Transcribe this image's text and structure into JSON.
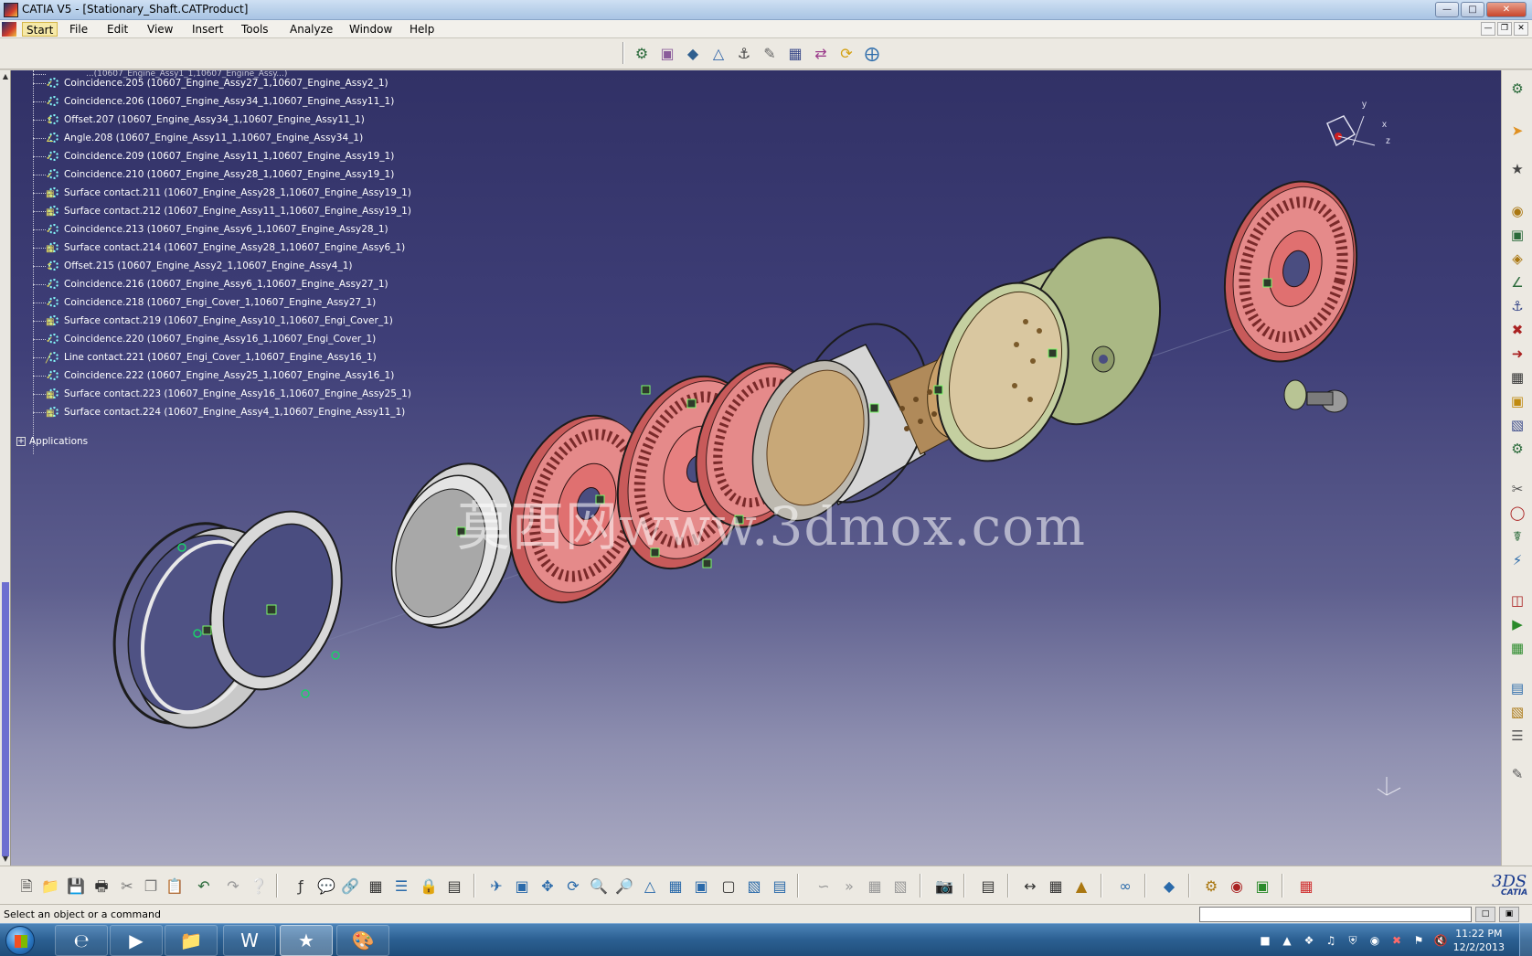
{
  "window": {
    "title": "CATIA V5 - [Stationary_Shaft.CATProduct]"
  },
  "menu": {
    "items": [
      "Start",
      "File",
      "Edit",
      "View",
      "Insert",
      "Tools",
      "Analyze",
      "Window",
      "Help"
    ]
  },
  "tree": {
    "partial_top": "...(10607_Engine_Assy1_1,10607_Engine_Assy...)",
    "rows": [
      {
        "label": "Coincidence.205 (10607_Engine_Assy27_1,10607_Engine_Assy2_1)",
        "icon": "coincidence-constraint-icon"
      },
      {
        "label": "Coincidence.206 (10607_Engine_Assy34_1,10607_Engine_Assy11_1)",
        "icon": "coincidence-constraint-icon"
      },
      {
        "label": "Offset.207 (10607_Engine_Assy34_1,10607_Engine_Assy11_1)",
        "icon": "offset-constraint-icon"
      },
      {
        "label": "Angle.208 (10607_Engine_Assy11_1,10607_Engine_Assy34_1)",
        "icon": "angle-constraint-icon"
      },
      {
        "label": "Coincidence.209 (10607_Engine_Assy11_1,10607_Engine_Assy19_1)",
        "icon": "coincidence-constraint-icon"
      },
      {
        "label": "Coincidence.210 (10607_Engine_Assy28_1,10607_Engine_Assy19_1)",
        "icon": "coincidence-constraint-icon"
      },
      {
        "label": "Surface contact.211 (10607_Engine_Assy28_1,10607_Engine_Assy19_1)",
        "icon": "surface-contact-constraint-icon"
      },
      {
        "label": "Surface contact.212 (10607_Engine_Assy11_1,10607_Engine_Assy19_1)",
        "icon": "surface-contact-constraint-icon"
      },
      {
        "label": "Coincidence.213 (10607_Engine_Assy6_1,10607_Engine_Assy28_1)",
        "icon": "coincidence-constraint-icon"
      },
      {
        "label": "Surface contact.214 (10607_Engine_Assy28_1,10607_Engine_Assy6_1)",
        "icon": "surface-contact-constraint-icon"
      },
      {
        "label": "Offset.215 (10607_Engine_Assy2_1,10607_Engine_Assy4_1)",
        "icon": "offset-constraint-icon"
      },
      {
        "label": "Coincidence.216 (10607_Engine_Assy6_1,10607_Engine_Assy27_1)",
        "icon": "coincidence-constraint-icon"
      },
      {
        "label": "Coincidence.218 (10607_Engi_Cover_1,10607_Engine_Assy27_1)",
        "icon": "coincidence-constraint-icon"
      },
      {
        "label": "Surface contact.219 (10607_Engine_Assy10_1,10607_Engi_Cover_1)",
        "icon": "surface-contact-constraint-icon"
      },
      {
        "label": "Coincidence.220 (10607_Engine_Assy16_1,10607_Engi_Cover_1)",
        "icon": "coincidence-constraint-icon"
      },
      {
        "label": "Line contact.221 (10607_Engi_Cover_1,10607_Engine_Assy16_1)",
        "icon": "line-contact-constraint-icon"
      },
      {
        "label": "Coincidence.222 (10607_Engine_Assy25_1,10607_Engine_Assy16_1)",
        "icon": "coincidence-constraint-icon"
      },
      {
        "label": "Surface contact.223 (10607_Engine_Assy16_1,10607_Engine_Assy25_1)",
        "icon": "surface-contact-constraint-icon"
      },
      {
        "label": "Surface contact.224 (10607_Engine_Assy4_1,10607_Engine_Assy11_1)",
        "icon": "surface-contact-constraint-icon"
      }
    ],
    "applications_label": "Applications"
  },
  "watermark": "莫西网www.3dmox.com",
  "compass": {
    "x": "x",
    "y": "y",
    "z": "z"
  },
  "status": {
    "message": "Select an object or a command",
    "command_value": ""
  },
  "taskbar": {
    "time": "11:22 PM",
    "date": "12/2/2013"
  },
  "colors": {
    "viewport_top": "#313166",
    "viewport_bottom": "#a9a9c1",
    "red_parts": "#e27a7a",
    "green_casing": "#b8c494",
    "grey_parts": "#d9d9d9",
    "tree_text": "#ffffff"
  },
  "brand": {
    "catia": "CATIA",
    "ds": "3DS"
  }
}
